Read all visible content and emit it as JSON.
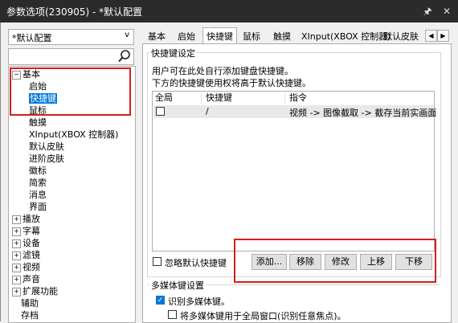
{
  "window": {
    "title": "参数选项(230905) - *默认配置",
    "pin_glyph": "🖈",
    "close_glyph": "✕"
  },
  "profile": {
    "value": "*默认配置",
    "arrow": "v"
  },
  "tree": {
    "items": [
      {
        "label": "基本",
        "expander": "−"
      },
      {
        "label": "启始"
      },
      {
        "label": "快捷键"
      },
      {
        "label": "鼠标"
      },
      {
        "label": "触摸"
      },
      {
        "label": "XInput(XBOX 控制器)"
      },
      {
        "label": "默认皮肤"
      },
      {
        "label": "进阶皮肤"
      },
      {
        "label": "徽标"
      },
      {
        "label": "简索"
      },
      {
        "label": "消息"
      },
      {
        "label": "界面"
      },
      {
        "label": "播放",
        "expander": "+"
      },
      {
        "label": "字幕",
        "expander": "+"
      },
      {
        "label": "设备",
        "expander": "+"
      },
      {
        "label": "滤镜",
        "expander": "+"
      },
      {
        "label": "视频",
        "expander": "+"
      },
      {
        "label": "声音",
        "expander": "+"
      },
      {
        "label": "扩展功能",
        "expander": "+"
      },
      {
        "label": "辅助"
      },
      {
        "label": "存档"
      }
    ]
  },
  "tabs": [
    "基本",
    "启始",
    "快捷键",
    "鼠标",
    "触摸",
    "XInput(XBOX 控制器)",
    "默认皮肤"
  ],
  "tab_scroll": {
    "left": "◀",
    "right": "▶"
  },
  "shortcut": {
    "group_label": "快捷键设定",
    "desc1": "用户可在此处自行添加键盘快捷键。",
    "desc2": "下方的快捷键使用权将高于默认快捷键。",
    "columns": [
      "全局",
      "快捷键",
      "指令"
    ],
    "row": {
      "key": "/",
      "command": "视频 -> 图像截取 -> 截存当前实画面"
    },
    "ignore_default": "忽略默认快捷键",
    "buttons": {
      "add": "添加...",
      "remove": "移除",
      "edit": "修改",
      "up": "上移",
      "down": "下移"
    }
  },
  "media": {
    "group_label": "多媒体键设置",
    "recognize": "识别多媒体键。",
    "global": "将多媒体键用于全局窗口(识别任意焦点)。"
  }
}
